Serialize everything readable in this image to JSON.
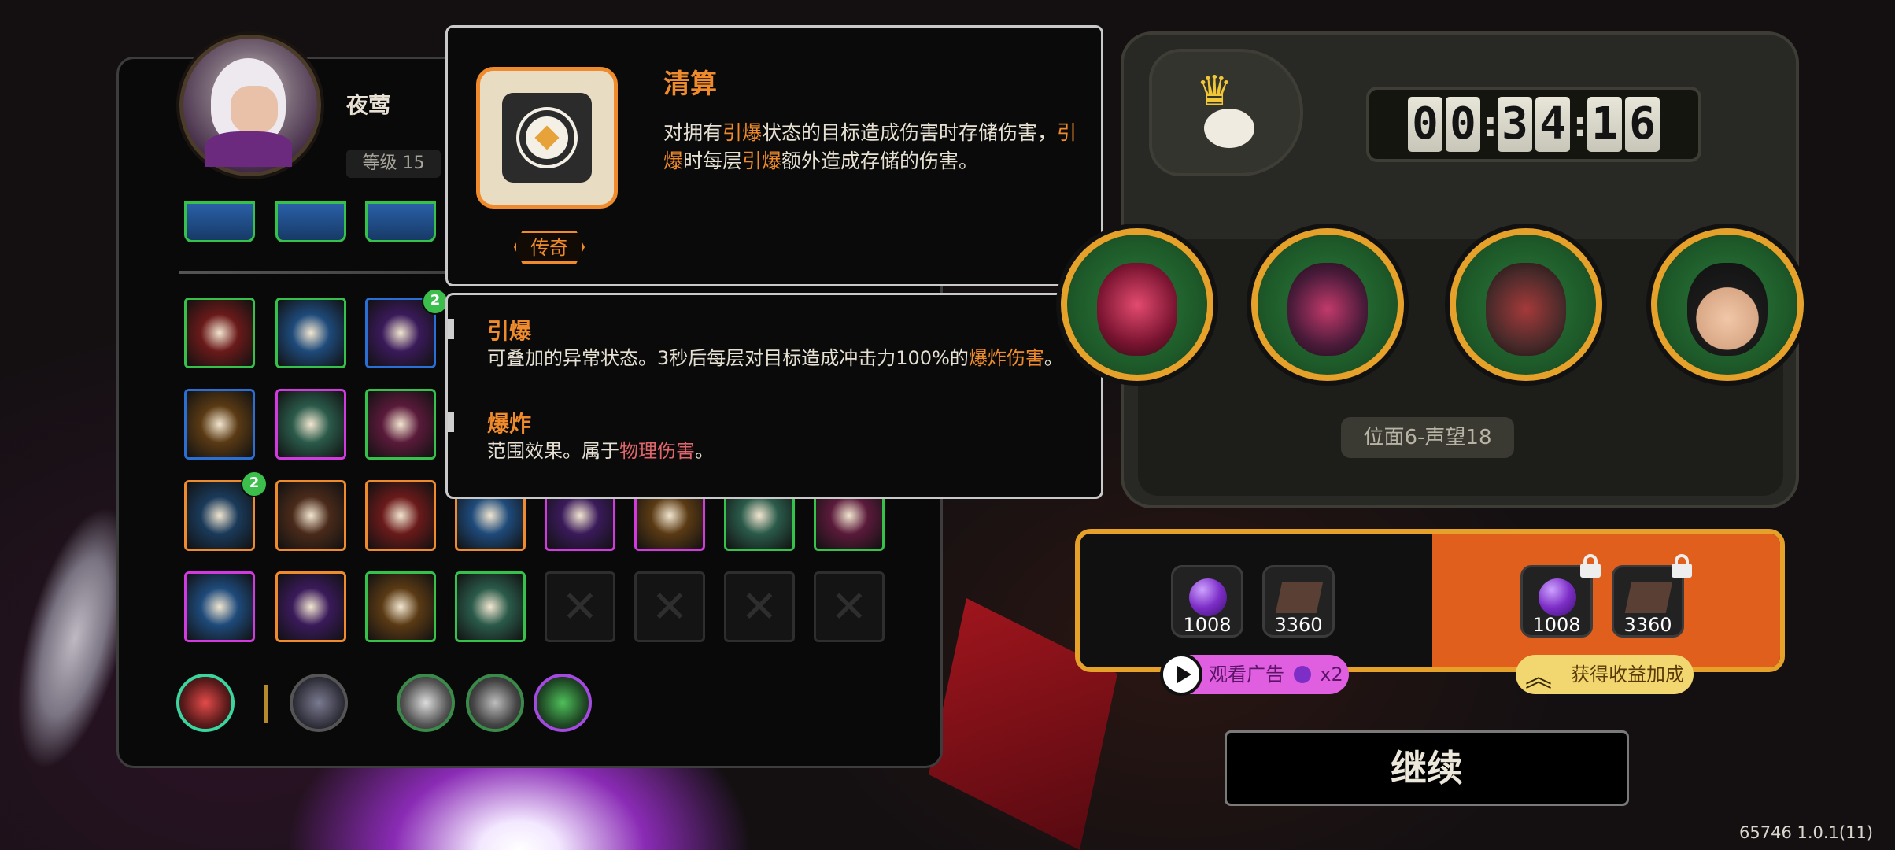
{
  "character": {
    "name": "夜莺",
    "level": "等级 15"
  },
  "loadout": {
    "top_row": [
      {
        "icon": "ice-dragon-skill-icon"
      },
      {
        "icon": "blue-eye-skill-icon"
      },
      {
        "icon": "storm-skill-icon"
      }
    ],
    "rows": [
      [
        {
          "icon": "demon-mask-skill-icon",
          "rarity": "green"
        },
        {
          "icon": "red-arrow-skill-icon",
          "rarity": "green"
        },
        {
          "icon": "blue-dragon-skill-icon",
          "rarity": "blue",
          "count": "2"
        }
      ],
      [
        {
          "icon": "finger-snap-skill-icon",
          "rarity": "blue"
        },
        {
          "icon": "lightning-bomb-skill-icon",
          "rarity": "purple"
        },
        {
          "icon": "flame-claw-skill-icon",
          "rarity": "green"
        }
      ],
      [
        {
          "icon": "gauntlet-skill-icon",
          "rarity": "orange",
          "count": "2"
        },
        {
          "icon": "chain-link-skill-icon",
          "rarity": "orange"
        },
        {
          "icon": "gear-skill-icon",
          "rarity": "orange"
        },
        {
          "icon": "blue-wing-skill-icon",
          "rarity": "orange"
        },
        {
          "icon": "spellbook-skill-icon",
          "rarity": "purple"
        },
        {
          "icon": "crossed-blades-skill-icon",
          "rarity": "purple"
        },
        {
          "icon": "spiral-skill-icon",
          "rarity": "green"
        },
        {
          "icon": "shatter-skill-icon",
          "rarity": "green"
        }
      ],
      [
        {
          "icon": "battery-skill-icon",
          "rarity": "purple"
        },
        {
          "icon": "vortex-skill-icon",
          "rarity": "orange"
        },
        {
          "icon": "star-orb-skill-icon",
          "rarity": "green"
        },
        {
          "icon": "rose-skill-icon",
          "rarity": "green"
        },
        {
          "icon": "empty-slot",
          "rarity": "empty"
        },
        {
          "icon": "empty-slot",
          "rarity": "empty"
        },
        {
          "icon": "empty-slot",
          "rarity": "empty"
        },
        {
          "icon": "empty-slot",
          "rarity": "empty"
        }
      ]
    ],
    "relics": [
      "flame-hand-relic-icon",
      "pistol-relic-icon",
      "scroll-relic-icon",
      "triangle-relic-icon",
      "shield-relic-icon"
    ]
  },
  "tooltip": {
    "title": "清算",
    "rarity": "传奇",
    "desc_parts": [
      {
        "text": "对拥有",
        "style": "normal"
      },
      {
        "text": "引爆",
        "style": "hl"
      },
      {
        "text": "状态的目标造成伤害时存储伤害，",
        "style": "normal"
      },
      {
        "text": "引爆",
        "style": "hl"
      },
      {
        "text": "时每层",
        "style": "normal"
      },
      {
        "text": "引爆",
        "style": "hl"
      },
      {
        "text": "额外造成存储的伤害。",
        "style": "normal"
      }
    ],
    "keywords": [
      {
        "name": "引爆",
        "parts": [
          {
            "text": "可叠加的异常状态。3秒后每层对目标造成冲击力100%的",
            "style": "normal"
          },
          {
            "text": "爆炸",
            "style": "hl"
          },
          {
            "text": "伤害",
            "style": "hl"
          },
          {
            "text": "。",
            "style": "normal"
          }
        ]
      },
      {
        "name": "爆炸",
        "parts": [
          {
            "text": "范围效果。属于",
            "style": "normal"
          },
          {
            "text": "物理伤害",
            "style": "hlr"
          },
          {
            "text": "。",
            "style": "normal"
          }
        ]
      }
    ]
  },
  "run": {
    "timer": {
      "h": [
        "0",
        "0"
      ],
      "m": [
        "3",
        "4"
      ],
      "s": [
        "1",
        "6"
      ]
    },
    "stage": "位面6-声望18",
    "enemies": [
      "fly-boss-portrait",
      "horned-demon-portrait",
      "hooded-bird-portrait",
      "glasses-kid-portrait"
    ]
  },
  "rewards": {
    "base": [
      {
        "icon": "purple-orb-icon",
        "amount": "1008"
      },
      {
        "icon": "card-fragment-icon",
        "amount": "3360"
      }
    ],
    "boosted": [
      {
        "icon": "purple-orb-boosted-icon",
        "amount": "1008"
      },
      {
        "icon": "card-fragment-boosted-icon",
        "amount": "3360"
      }
    ],
    "ad_label": "观看广告",
    "ad_multiplier": "x2",
    "boost_label": "获得收益加成"
  },
  "continue_label": "继续",
  "version": "65746 1.0.1(11)",
  "colors": {
    "legendary": "#ef8b2c",
    "rare_green": "#36c14a",
    "epic_purple": "#d23ae0",
    "gold_ring": "#e5a12a"
  }
}
